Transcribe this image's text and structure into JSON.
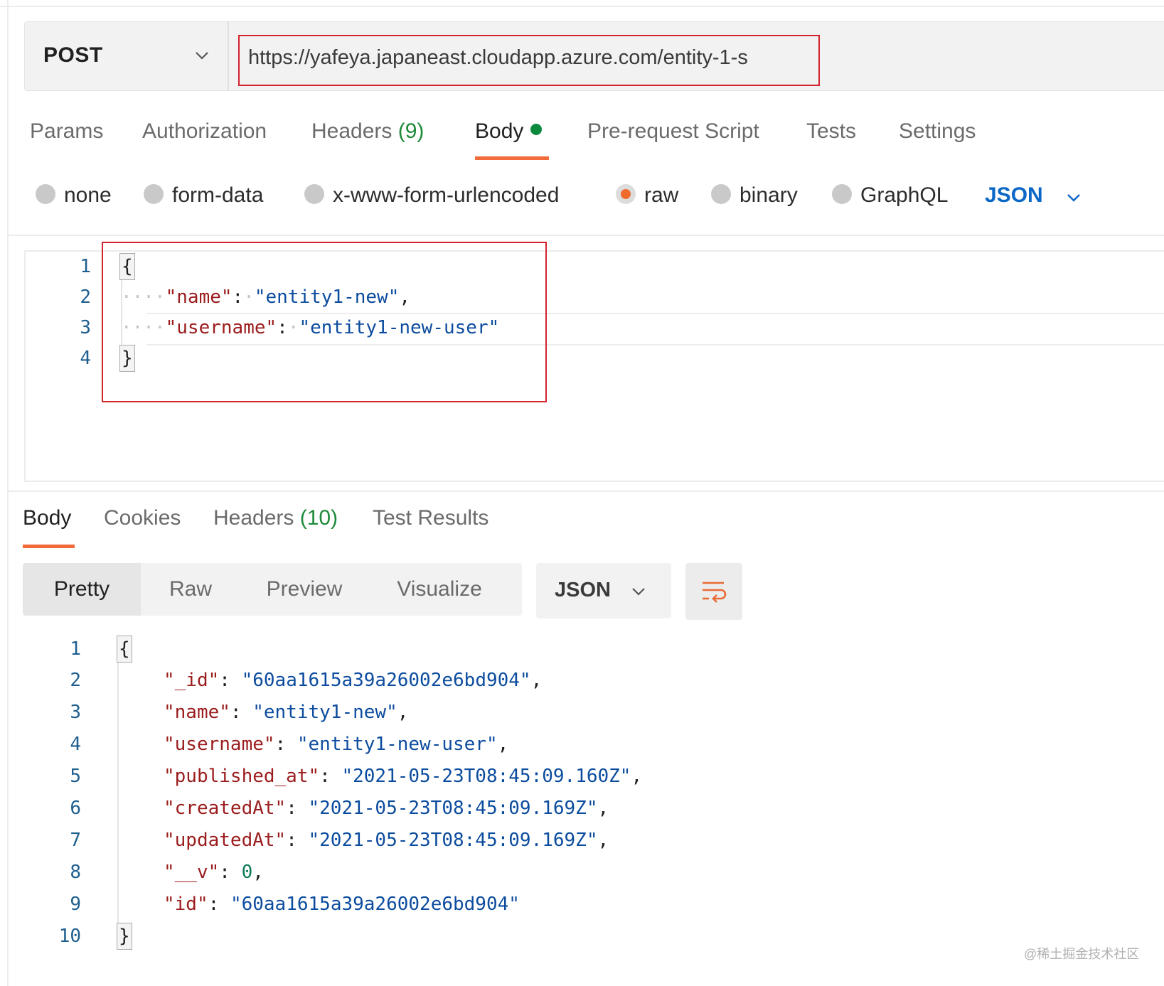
{
  "request": {
    "method": "POST",
    "url": "https://yafeya.japaneast.cloudapp.azure.com/entity-1-s"
  },
  "request_tabs": [
    {
      "label": "Params"
    },
    {
      "label": "Authorization"
    },
    {
      "label": "Headers",
      "count": "(9)"
    },
    {
      "label": "Body",
      "active": true
    },
    {
      "label": "Pre-request Script"
    },
    {
      "label": "Tests"
    },
    {
      "label": "Settings"
    }
  ],
  "body_types": [
    {
      "label": "none"
    },
    {
      "label": "form-data"
    },
    {
      "label": "x-www-form-urlencoded"
    },
    {
      "label": "raw",
      "selected": true
    },
    {
      "label": "binary"
    },
    {
      "label": "GraphQL"
    }
  ],
  "body_format": "JSON",
  "request_body_lines": [
    {
      "n": "1",
      "text": "{"
    },
    {
      "n": "2",
      "key": "\"name\"",
      "value": "\"entity1-new\"",
      "trail": ","
    },
    {
      "n": "3",
      "key": "\"username\"",
      "value": "\"entity1-new-user\"",
      "trail": ""
    },
    {
      "n": "4",
      "text": "}"
    }
  ],
  "response_tabs": [
    {
      "label": "Body",
      "active": true
    },
    {
      "label": "Cookies"
    },
    {
      "label": "Headers",
      "count": "(10)"
    },
    {
      "label": "Test Results"
    }
  ],
  "view_modes": [
    "Pretty",
    "Raw",
    "Preview",
    "Visualize"
  ],
  "response_format": "JSON",
  "response_lines": [
    {
      "n": "1",
      "text": "{"
    },
    {
      "n": "2",
      "key": "\"_id\"",
      "value": "\"60aa1615a39a26002e6bd904\"",
      "trail": ","
    },
    {
      "n": "3",
      "key": "\"name\"",
      "value": "\"entity1-new\"",
      "trail": ","
    },
    {
      "n": "4",
      "key": "\"username\"",
      "value": "\"entity1-new-user\"",
      "trail": ","
    },
    {
      "n": "5",
      "key": "\"published_at\"",
      "value": "\"2021-05-23T08:45:09.160Z\"",
      "trail": ","
    },
    {
      "n": "6",
      "key": "\"createdAt\"",
      "value": "\"2021-05-23T08:45:09.169Z\"",
      "trail": ","
    },
    {
      "n": "7",
      "key": "\"updatedAt\"",
      "value": "\"2021-05-23T08:45:09.169Z\"",
      "trail": ","
    },
    {
      "n": "8",
      "key": "\"__v\"",
      "number": "0",
      "trail": ","
    },
    {
      "n": "9",
      "key": "\"id\"",
      "value": "\"60aa1615a39a26002e6bd904\"",
      "trail": ""
    },
    {
      "n": "10",
      "text": "}"
    }
  ],
  "watermark": "@稀土掘金技术社区",
  "colors": {
    "accent": "#f26b3a",
    "highlight_box": "#d3242f",
    "json_key": "#9b1c1c",
    "json_string": "#0c4c9e",
    "json_number": "#0a7a58",
    "count_green": "#1e8a3a",
    "format_blue": "#0b67c7"
  }
}
